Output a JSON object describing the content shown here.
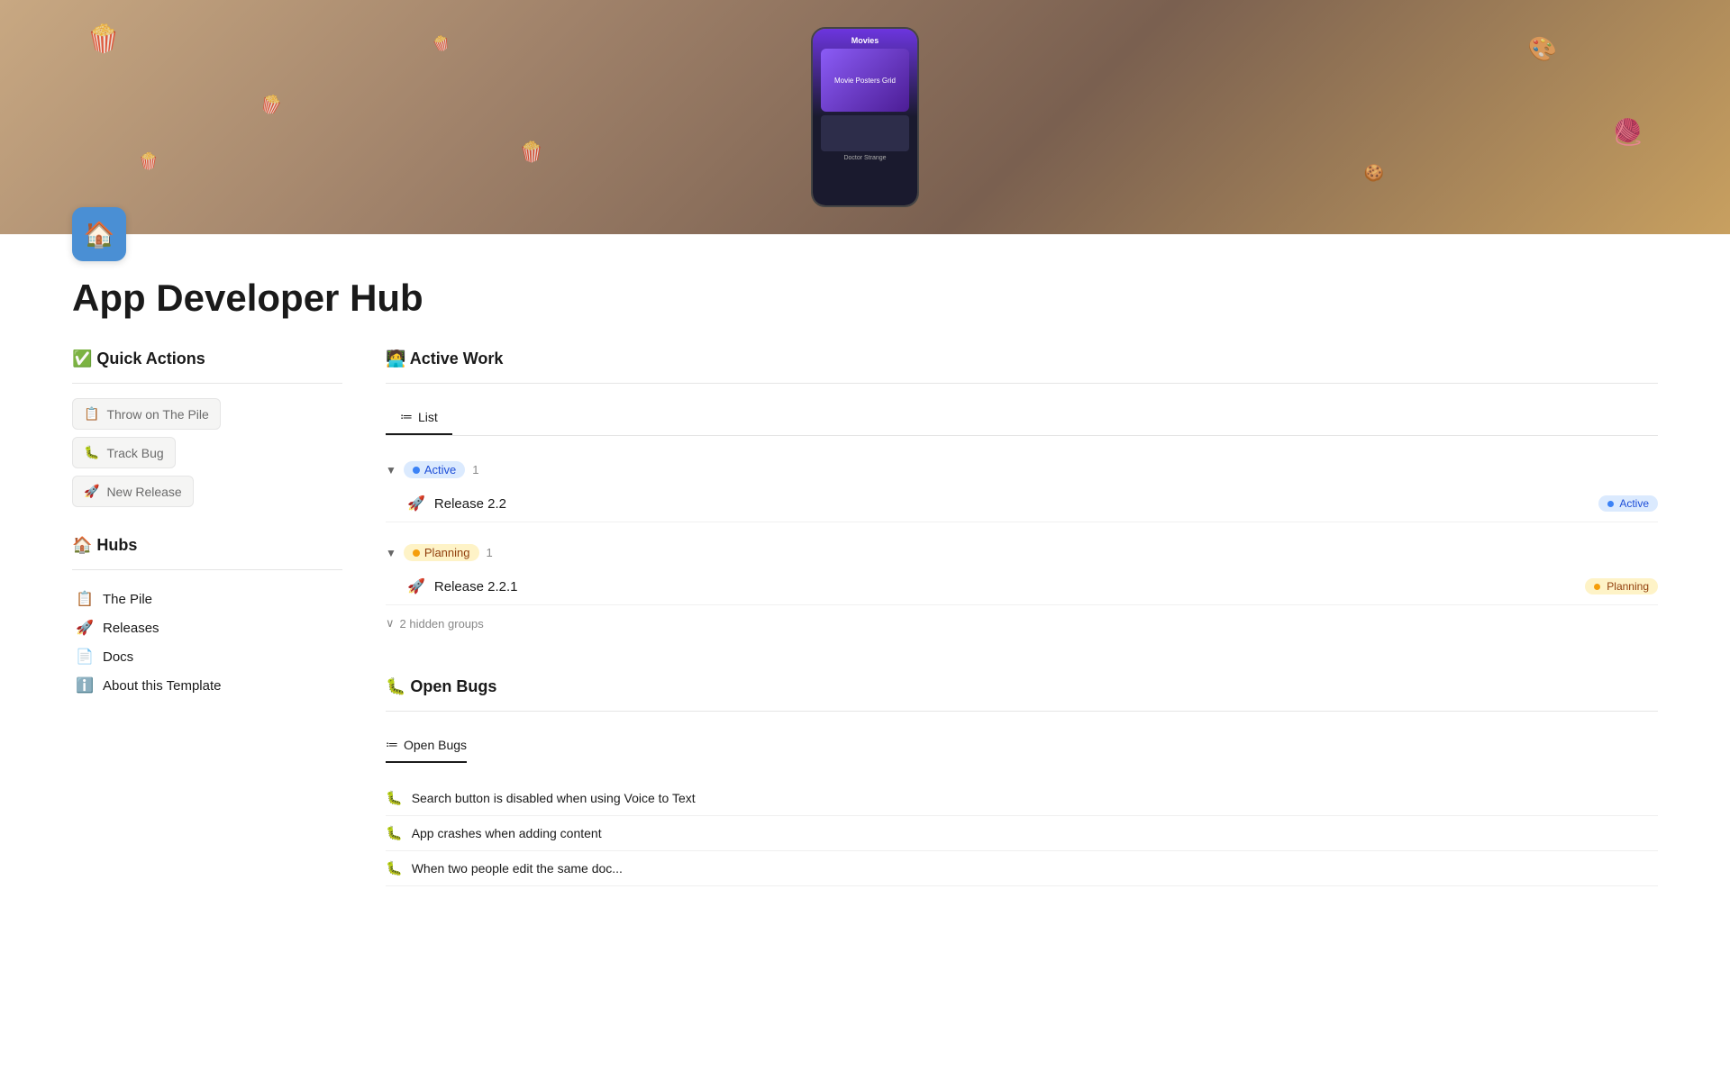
{
  "page": {
    "title": "App Developer Hub",
    "icon": "🏠"
  },
  "hero": {
    "alt": "Movies app on phone with popcorn"
  },
  "quick_actions": {
    "header": "✅ Quick Actions",
    "buttons": [
      {
        "id": "throw-on-pile",
        "icon": "📋",
        "label": "Throw on The Pile"
      },
      {
        "id": "track-bug",
        "icon": "🐛",
        "label": "Track Bug"
      },
      {
        "id": "new-release",
        "icon": "🚀",
        "label": "New Release"
      }
    ]
  },
  "hubs": {
    "header": "🏠 Hubs",
    "items": [
      {
        "id": "the-pile",
        "icon": "📋",
        "label": "The Pile"
      },
      {
        "id": "releases",
        "icon": "🚀",
        "label": "Releases"
      },
      {
        "id": "docs",
        "icon": "📄",
        "label": "Docs"
      },
      {
        "id": "about-template",
        "icon": "ℹ️",
        "label": "About this Template"
      }
    ]
  },
  "active_work": {
    "header": "🧑‍💻 Active Work",
    "tabs": [
      {
        "id": "list",
        "icon": "≔",
        "label": "List",
        "active": true
      }
    ],
    "groups": [
      {
        "id": "active-group",
        "status": "Active",
        "badge_class": "badge-active",
        "dot_class": "dot-blue",
        "pill_class": "pill-active",
        "count": 1,
        "items": [
          {
            "id": "release-2-2",
            "icon": "🚀",
            "label": "Release 2.2",
            "status": "Active"
          }
        ]
      },
      {
        "id": "planning-group",
        "status": "Planning",
        "badge_class": "badge-planning",
        "dot_class": "dot-yellow",
        "pill_class": "pill-planning",
        "count": 1,
        "items": [
          {
            "id": "release-2-2-1",
            "icon": "🚀",
            "label": "Release 2.2.1",
            "status": "Planning"
          }
        ]
      }
    ],
    "hidden_groups": "2 hidden groups"
  },
  "open_bugs": {
    "header": "🐛 Open Bugs",
    "tab_label": "Open Bugs",
    "tab_icon": "≔",
    "items": [
      {
        "id": "bug-1",
        "icon": "🐛",
        "label": "Search button is disabled when using Voice to Text"
      },
      {
        "id": "bug-2",
        "icon": "🐛",
        "label": "App crashes when adding content"
      },
      {
        "id": "bug-3",
        "icon": "🐛",
        "label": "When two people edit the same doc..."
      }
    ]
  }
}
